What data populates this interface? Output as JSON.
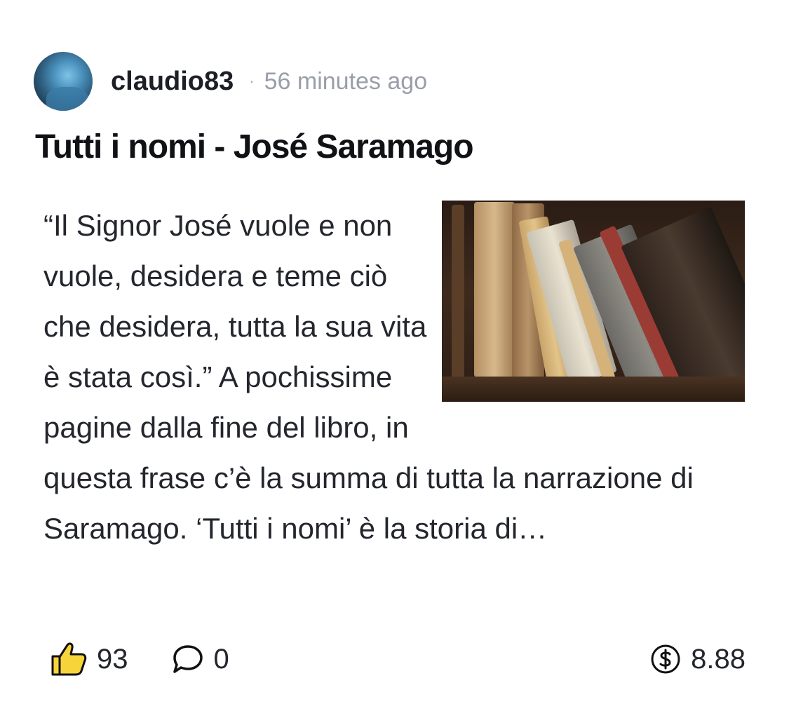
{
  "post": {
    "author": "claudio83",
    "separator": "·",
    "timestamp": "56 minutes ago",
    "title": "Tutti i nomi - José Saramago",
    "excerpt": "“Il Signor José vuole e non vuole, desidera e teme ciò che desidera, tutta la sua vita è stata così.” A pochissime pagine dalla fine del libro, in questa frase c’è la summa di tutta la narrazione di Saramago. ‘Tutti i nomi’ è la storia di…"
  },
  "stats": {
    "likes": "93",
    "comments": "0",
    "earnings": "8.88"
  },
  "icons": {
    "like": "thumbs-up-icon",
    "comment": "comment-bubble-icon",
    "earnings": "dollar-coin-icon"
  },
  "colors": {
    "like_fill": "#f7d43a",
    "text": "#24262d",
    "muted": "#9a9ea8"
  }
}
